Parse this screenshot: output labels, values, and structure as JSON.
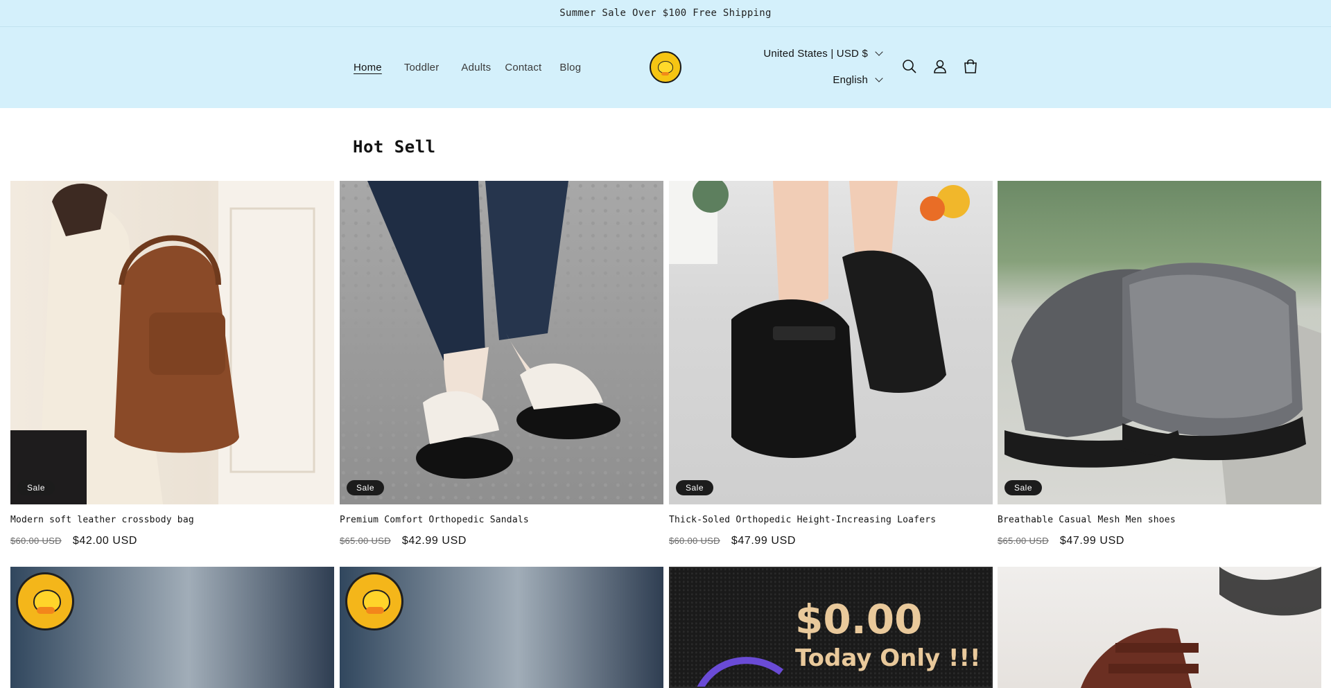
{
  "announcement": "Summer Sale Over $100 Free Shipping",
  "nav": [
    "Home",
    "Toddler",
    "Adults",
    "Contact",
    "Blog"
  ],
  "localization": {
    "country": "United States | USD $",
    "language": "English"
  },
  "icons": [
    "search-icon",
    "account-icon",
    "cart-icon"
  ],
  "section": {
    "title": "Hot Sell"
  },
  "products": [
    {
      "title": "Modern soft leather crossbody bag",
      "compare": "$60.00 USD",
      "price": "$42.00 USD",
      "badge": "Sale"
    },
    {
      "title": "Premium Comfort Orthopedic Sandals",
      "compare": "$65.00 USD",
      "price": "$42.99 USD",
      "badge": "Sale"
    },
    {
      "title": "Thick-Soled Orthopedic Height-Increasing Loafers",
      "compare": "$60.00 USD",
      "price": "$47.99 USD",
      "badge": "Sale"
    },
    {
      "title": "Breathable Casual Mesh Men shoes",
      "compare": "$65.00 USD",
      "price": "$47.99 USD",
      "badge": "Sale"
    }
  ],
  "promo": {
    "line1": "$0.00",
    "line2": "Today Only !!!"
  },
  "colors": {
    "header_bg": "#d4f0fb",
    "badge_bg": "#1c1c1c",
    "text": "#121212"
  }
}
